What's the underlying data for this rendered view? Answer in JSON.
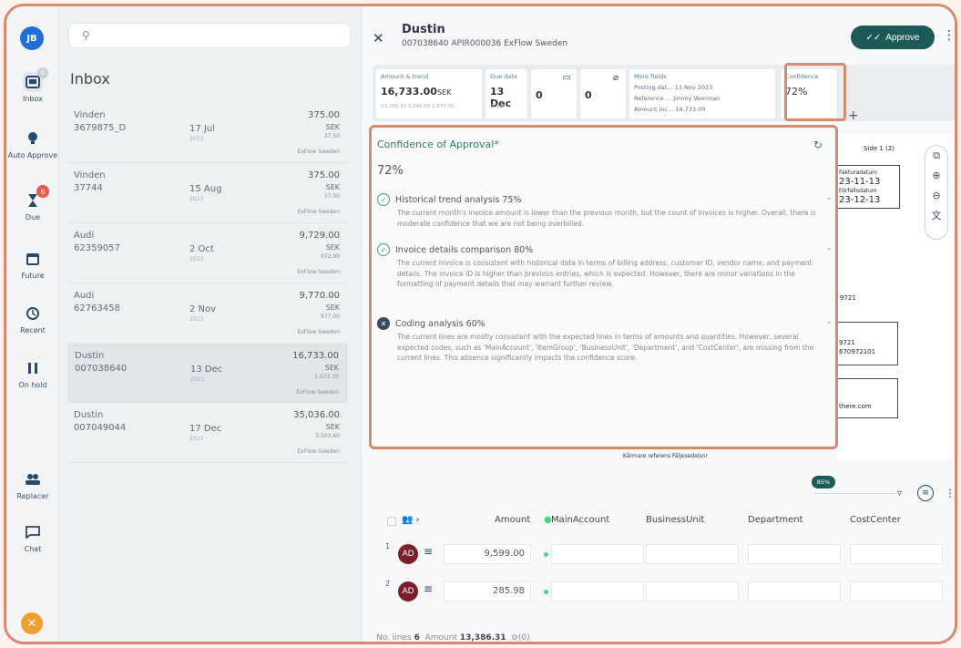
{
  "rail": {
    "avatar": "JB",
    "inbox": {
      "label": "Inbox",
      "badge": "6"
    },
    "auto_approve": {
      "label": "Auto Approve"
    },
    "due": {
      "label": "Due",
      "badge": "6"
    },
    "future": {
      "label": "Future"
    },
    "recent": {
      "label": "Recent"
    },
    "on_hold": {
      "label": "On hold"
    },
    "replacer": {
      "label": "Replacer"
    },
    "chat": {
      "label": "Chat"
    }
  },
  "list": {
    "title": "Inbox",
    "items": [
      {
        "vendor": "Vinden",
        "number": "3679875_D",
        "date": "17 Jul",
        "year": "2023",
        "amount": "375.00",
        "currency": "SEK",
        "vat": "37.50",
        "company": "ExFlow Sweden"
      },
      {
        "vendor": "Vinden",
        "number": "37744",
        "date": "15 Aug",
        "year": "2023",
        "amount": "375.00",
        "currency": "SEK",
        "vat": "37.50",
        "company": "ExFlow Sweden"
      },
      {
        "vendor": "Audi",
        "number": "62359057",
        "date": "2 Oct",
        "year": "2023",
        "amount": "9,729.00",
        "currency": "SEK",
        "vat": "972.90",
        "company": "ExFlow Sweden"
      },
      {
        "vendor": "Audi",
        "number": "62763458",
        "date": "2 Nov",
        "year": "2023",
        "amount": "9,770.00",
        "currency": "SEK",
        "vat": "977.00",
        "company": "ExFlow Sweden"
      },
      {
        "vendor": "Dustin",
        "number": "007038640",
        "date": "13 Dec",
        "year": "2023",
        "amount": "16,733.00",
        "currency": "SEK",
        "vat": "1,673.30",
        "company": "ExFlow Sweden"
      },
      {
        "vendor": "Dustin",
        "number": "007049044",
        "date": "17 Dec",
        "year": "2023",
        "amount": "35,036.00",
        "currency": "SEK",
        "vat": "3,503.60",
        "company": "ExFlow Sweden"
      }
    ]
  },
  "detail": {
    "title": "Dustin",
    "subtitle": "007038640  APIR000036  ExFlow Sweden",
    "approve_label": "Approve",
    "cards": {
      "amount_label": "Amount & trend",
      "amount_value": "16,733.00",
      "amount_currency": "SEK",
      "amount_small": "13,386.31  3,346.69  1,673.30",
      "due_label": "Due date",
      "due_value": "13 Dec",
      "due_year": "2023",
      "comments_count": "0",
      "attachments_count": "0",
      "more_label": "More fields",
      "more_line1": "Posting dat... 13 Nov 2023",
      "more_line2": "Reference ... Jimmy Veerman",
      "more_line3": "Amount inc... 16,733.00",
      "confidence_label": "Confidence",
      "confidence_value": "72%"
    }
  },
  "popover": {
    "title": "Confidence of Approval*",
    "percent": "72%",
    "sections": [
      {
        "heading": "Historical trend analysis 75%",
        "body": "The current month's invoice amount is lower than the previous month, but the count of invoices is higher. Overall, there is moderate confidence that we are not being overbilled.",
        "status": "ok"
      },
      {
        "heading": "Invoice details comparison 80%",
        "body": "The current invoice is consistent with historical data in terms of billing address, customer ID, vendor name, and payment details. The invoice ID is higher than previous entries, which is expected. However, there are minor variations in the formatting of payment details that may warrant further review.",
        "status": "ok"
      },
      {
        "heading": "Coding analysis 60%",
        "body": "The current lines are mostly consistent with the expected lines in terms of amounts and quantities. However, several expected codes, such as 'MainAccount', 'ItemGroup', 'BusinessUnit', 'Department', and 'CostCenter', are missing from the current lines. This absence significantly impacts the confidence score.",
        "status": "fail"
      }
    ]
  },
  "viewer": {
    "page": "Side 1 (2)",
    "f1_label": "Fakturadatum",
    "f1_value": "23-11-13",
    "f2_label": "Förfallodatum",
    "f2_value": "23-12-13",
    "t1": "9721",
    "t2": "9721",
    "t3": "670972101",
    "t4": "there.com",
    "bottom": "Kårmare referens  Fåljesedelsnr"
  },
  "grid": {
    "progress": "85%",
    "headers": {
      "amount": "Amount",
      "main_account": "MainAccount",
      "business_unit": "BusinessUnit",
      "department": "Department",
      "cost_center": "CostCenter"
    },
    "rows": [
      {
        "n": "1",
        "avatar": "AD",
        "amount": "9,599.00"
      },
      {
        "n": "2",
        "avatar": "AD",
        "amount": "285.98"
      }
    ]
  },
  "footer": {
    "lines_label": "No. lines",
    "lines_value": "6",
    "amount_label": "Amount",
    "amount_value": "13,386.31",
    "attach": "(0)"
  }
}
